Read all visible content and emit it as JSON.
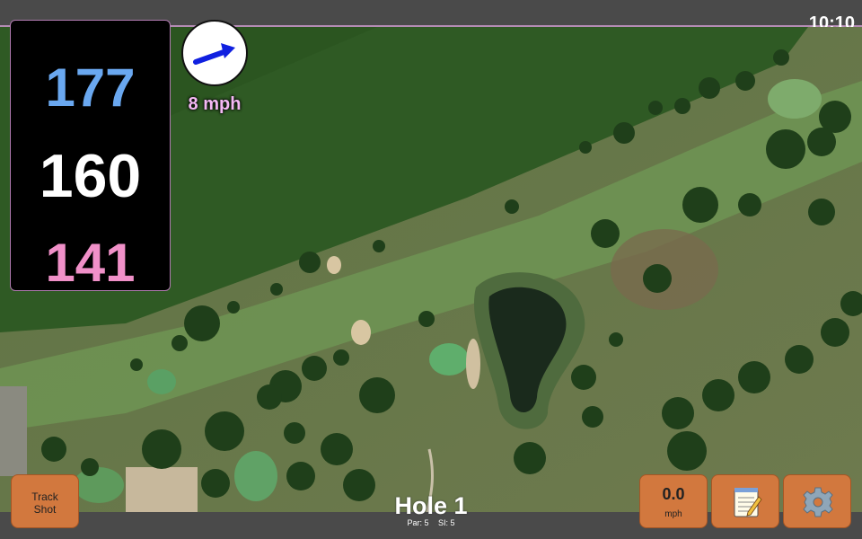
{
  "status": {
    "time": "10:10"
  },
  "distances": {
    "back": "177",
    "center": "160",
    "front": "141"
  },
  "wind": {
    "speed_label": "8 mph",
    "arrow_color": "#1020e0"
  },
  "hole": {
    "title": "Hole 1",
    "par": "Par: 5",
    "si": "SI: 5"
  },
  "buttons": {
    "track_shot": [
      "Track",
      "Shot"
    ],
    "speed_value": "0.0",
    "speed_unit": "mph",
    "notes_icon": "notepad-icon",
    "settings_icon": "gear-icon"
  },
  "colors": {
    "back_distance": "#6aa8f0",
    "center_distance": "#ffffff",
    "front_distance": "#f090c8",
    "button_bg": "#d2783e",
    "wind_label": "#f4b8f4"
  }
}
